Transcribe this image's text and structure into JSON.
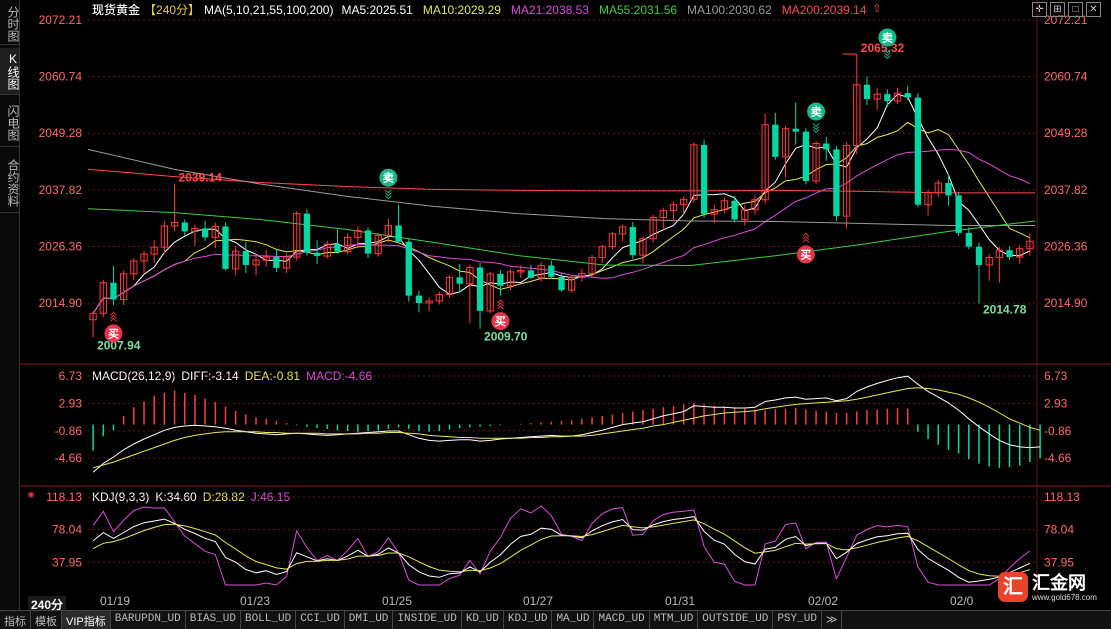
{
  "nav_tabs": [
    "分时图",
    "K线图",
    "闪电图",
    "合约资料"
  ],
  "nav_active": 1,
  "header": {
    "title": "现货黄金",
    "period_tag": "【240分】",
    "ma_params": "MA(5,10,21,55,100,200)",
    "ma_values": [
      {
        "label": "MA5:2025.51",
        "color": "#ffffff"
      },
      {
        "label": "MA10:2029.29",
        "color": "#e6e65c"
      },
      {
        "label": "MA21:2038.53",
        "color": "#d94ed9"
      },
      {
        "label": "MA55:2031.56",
        "color": "#3fcf3f"
      },
      {
        "label": "MA100:2030.62",
        "color": "#9a9a9a"
      },
      {
        "label": "MA200:2039.14",
        "color": "#ff4a4a"
      }
    ]
  },
  "colors": {
    "up": "#ff3b3b",
    "down": "#00d8a4",
    "bg": "#000000",
    "grid": "#5a1a1a"
  },
  "price_axis_ticks": [
    "2072.21",
    "2060.74",
    "2049.28",
    "2037.82",
    "2026.36",
    "2014.90"
  ],
  "macd_panel": {
    "title": "MACD(26,12,9)",
    "diff": "DIFF:-3.14",
    "dea": "DEA:-0.81",
    "macd": "MACD:-4.66",
    "ticks": [
      "6.73",
      "2.93",
      "-0.86",
      "-4.66"
    ]
  },
  "kdj_panel": {
    "title": "KDJ(9,3,3)",
    "k": "K:34.60",
    "d": "D:28.82",
    "j": "J:46.15",
    "ticks": [
      "118.13",
      "78.04",
      "37.95"
    ]
  },
  "annotations": {
    "high": "2065.32",
    "low_a": "2007.94",
    "low_b": "2009.70",
    "low_c": "2014.78",
    "prev_high": "2039.14",
    "buy": "买",
    "sell": "卖"
  },
  "period_label": "240分",
  "date_labels": [
    "01/19",
    "01/23",
    "01/25",
    "01/27",
    "01/31",
    "02/02",
    "02/0"
  ],
  "bottom_tabs": [
    "指标",
    "模板",
    "VIP指标",
    "BARUPDN_UD",
    "BIAS_UD",
    "BOLL_UD",
    "CCI_UD",
    "DMI_UD",
    "INSIDE_UD",
    "KD_UD",
    "KDJ_UD",
    "MA_UD",
    "MACD_UD",
    "MTM_UD",
    "OUTSIDE_UD",
    "PSY_UD",
    "≫"
  ],
  "bottom_active": 2,
  "logo": {
    "mark": "汇",
    "name": "汇金网",
    "url": "www.gold678.com"
  },
  "chart_data": {
    "type": "candlestick",
    "candles": [
      [
        2011.5,
        2013.2,
        2007.9,
        2012.8
      ],
      [
        2012.8,
        2019.6,
        2012.0,
        2019.0
      ],
      [
        2019.0,
        2022.4,
        2014.5,
        2015.6
      ],
      [
        2015.6,
        2021.5,
        2014.5,
        2020.8
      ],
      [
        2020.8,
        2024.0,
        2019.5,
        2023.4
      ],
      [
        2023.4,
        2025.5,
        2021.0,
        2024.8
      ],
      [
        2024.8,
        2027.6,
        2023.0,
        2026.2
      ],
      [
        2026.2,
        2031.5,
        2025.0,
        2030.5
      ],
      [
        2030.5,
        2039.1,
        2029.5,
        2031.2
      ],
      [
        2031.2,
        2031.8,
        2028.6,
        2029.4
      ],
      [
        2029.4,
        2030.8,
        2026.5,
        2030.0
      ],
      [
        2030.0,
        2031.5,
        2027.5,
        2028.2
      ],
      [
        2028.2,
        2031.2,
        2026.0,
        2030.4
      ],
      [
        2030.4,
        2031.2,
        2021.5,
        2021.8
      ],
      [
        2021.8,
        2026.5,
        2020.5,
        2025.4
      ],
      [
        2025.4,
        2027.2,
        2021.0,
        2022.6
      ],
      [
        2022.6,
        2024.8,
        2020.5,
        2023.6
      ],
      [
        2023.6,
        2025.6,
        2022.2,
        2024.2
      ],
      [
        2024.2,
        2025.8,
        2021.2,
        2022.0
      ],
      [
        2022.0,
        2024.9,
        2021.0,
        2024.2
      ],
      [
        2024.2,
        2033.5,
        2023.5,
        2033.0
      ],
      [
        2033.0,
        2033.8,
        2024.5,
        2025.1
      ],
      [
        2025.1,
        2027.6,
        2022.8,
        2024.4
      ],
      [
        2024.4,
        2027.5,
        2023.9,
        2026.8
      ],
      [
        2026.8,
        2029.8,
        2024.9,
        2025.3
      ],
      [
        2025.3,
        2029.0,
        2024.8,
        2028.2
      ],
      [
        2028.2,
        2030.4,
        2026.0,
        2029.6
      ],
      [
        2029.6,
        2030.2,
        2024.0,
        2024.9
      ],
      [
        2024.9,
        2029.1,
        2024.3,
        2028.6
      ],
      [
        2028.6,
        2032.0,
        2027.2,
        2030.6
      ],
      [
        2030.6,
        2034.8,
        2027.0,
        2027.3
      ],
      [
        2027.3,
        2028.0,
        2015.2,
        2016.4
      ],
      [
        2016.4,
        2017.4,
        2013.0,
        2014.9
      ],
      [
        2014.9,
        2016.0,
        2013.2,
        2015.3
      ],
      [
        2015.3,
        2017.2,
        2014.6,
        2016.6
      ],
      [
        2016.6,
        2020.5,
        2015.9,
        2020.1
      ],
      [
        2020.1,
        2022.8,
        2017.0,
        2018.8
      ],
      [
        2018.8,
        2022.5,
        2010.8,
        2022.1
      ],
      [
        2022.1,
        2023.0,
        2009.7,
        2013.3
      ],
      [
        2013.3,
        2021.2,
        2012.8,
        2020.8
      ],
      [
        2020.8,
        2021.6,
        2016.4,
        2018.4
      ],
      [
        2018.4,
        2021.8,
        2017.5,
        2021.2
      ],
      [
        2021.2,
        2022.5,
        2020.0,
        2021.5
      ],
      [
        2021.5,
        2022.6,
        2019.8,
        2020.0
      ],
      [
        2020.0,
        2023.2,
        2019.2,
        2022.5
      ],
      [
        2022.5,
        2023.5,
        2019.8,
        2020.2
      ],
      [
        2020.2,
        2020.9,
        2017.2,
        2017.5
      ],
      [
        2017.5,
        2020.6,
        2017.0,
        2020.1
      ],
      [
        2020.1,
        2021.8,
        2019.2,
        2020.9
      ],
      [
        2020.9,
        2024.6,
        2020.2,
        2024.1
      ],
      [
        2024.1,
        2026.7,
        2023.0,
        2026.3
      ],
      [
        2026.3,
        2029.3,
        2025.7,
        2028.9
      ],
      [
        2028.9,
        2030.8,
        2027.4,
        2030.3
      ],
      [
        2030.3,
        2031.3,
        2023.8,
        2024.6
      ],
      [
        2024.6,
        2028.4,
        2023.0,
        2027.9
      ],
      [
        2027.9,
        2032.7,
        2027.1,
        2032.2
      ],
      [
        2032.2,
        2034.2,
        2030.0,
        2033.6
      ],
      [
        2033.6,
        2035.5,
        2031.4,
        2034.8
      ],
      [
        2034.8,
        2036.5,
        2032.8,
        2035.9
      ],
      [
        2035.9,
        2047.4,
        2035.2,
        2046.9
      ],
      [
        2046.9,
        2048.0,
        2032.2,
        2032.9
      ],
      [
        2032.9,
        2034.8,
        2031.0,
        2033.8
      ],
      [
        2033.8,
        2036.3,
        2033.0,
        2035.6
      ],
      [
        2035.6,
        2036.6,
        2031.2,
        2031.8
      ],
      [
        2031.8,
        2034.7,
        2030.6,
        2033.8
      ],
      [
        2033.8,
        2036.7,
        2032.8,
        2035.8
      ],
      [
        2035.8,
        2053.2,
        2035.0,
        2051.0
      ],
      [
        2051.0,
        2053.4,
        2043.9,
        2044.5
      ],
      [
        2044.5,
        2050.8,
        2040.3,
        2050.2
      ],
      [
        2050.2,
        2055.5,
        2047.0,
        2049.6
      ],
      [
        2049.6,
        2050.3,
        2038.9,
        2039.6
      ],
      [
        2039.6,
        2047.7,
        2039.0,
        2047.2
      ],
      [
        2047.2,
        2048.5,
        2043.7,
        2046.0
      ],
      [
        2046.0,
        2046.7,
        2031.5,
        2032.5
      ],
      [
        2032.5,
        2047.5,
        2030.0,
        2046.8
      ],
      [
        2046.8,
        2065.3,
        2045.0,
        2059.1
      ],
      [
        2059.1,
        2060.8,
        2055.0,
        2056.2
      ],
      [
        2056.2,
        2058.4,
        2054.0,
        2057.2
      ],
      [
        2057.2,
        2058.2,
        2054.6,
        2055.8
      ],
      [
        2055.8,
        2058.5,
        2055.2,
        2057.4
      ],
      [
        2057.4,
        2058.9,
        2056.0,
        2056.5
      ],
      [
        2056.5,
        2057.4,
        2034.3,
        2034.8
      ],
      [
        2034.8,
        2037.8,
        2032.6,
        2037.2
      ],
      [
        2037.2,
        2039.9,
        2036.4,
        2039.2
      ],
      [
        2039.2,
        2041.0,
        2034.6,
        2036.7
      ],
      [
        2036.7,
        2037.4,
        2028.5,
        2029.1
      ],
      [
        2029.1,
        2030.2,
        2025.8,
        2026.3
      ],
      [
        2026.3,
        2027.1,
        2014.8,
        2022.6
      ],
      [
        2022.6,
        2024.8,
        2019.4,
        2024.1
      ],
      [
        2024.1,
        2026.2,
        2019.0,
        2025.6
      ],
      [
        2025.6,
        2026.3,
        2023.6,
        2024.2
      ],
      [
        2024.2,
        2026.6,
        2022.8,
        2025.9
      ],
      [
        2025.9,
        2029.0,
        2024.5,
        2027.4
      ]
    ],
    "macd_hist": [
      -3.6,
      -1.6,
      -0.8,
      1.2,
      2.4,
      3.2,
      4.0,
      4.4,
      4.7,
      4.4,
      4.1,
      3.6,
      3.1,
      2.5,
      1.9,
      1.4,
      1.0,
      0.8,
      0.5,
      0.2,
      -0.1,
      -0.3,
      -0.5,
      -0.6,
      -0.8,
      -0.9,
      -1.0,
      -0.9,
      -0.8,
      -0.6,
      -0.4,
      -0.6,
      -0.9,
      -1.0,
      -0.9,
      -0.7,
      -0.5,
      -0.4,
      -0.3,
      -0.2,
      -0.1,
      0.0,
      0.1,
      0.2,
      0.3,
      0.4,
      0.5,
      0.6,
      0.8,
      1.0,
      1.2,
      1.4,
      1.6,
      1.8,
      2.0,
      2.2,
      2.4,
      2.6,
      2.8,
      3.0,
      2.8,
      2.6,
      2.5,
      2.4,
      2.2,
      2.1,
      2.0,
      2.1,
      2.2,
      2.3,
      2.1,
      1.9,
      1.8,
      1.6,
      1.6,
      1.8,
      2.0,
      2.1,
      2.2,
      2.3,
      2.2,
      -1.0,
      -2.0,
      -2.8,
      -3.5,
      -4.0,
      -4.8,
      -5.4,
      -5.8,
      -6.0,
      -5.9,
      -5.7,
      -5.2,
      -4.7
    ],
    "diff": [
      -6.6,
      -5.4,
      -4.5,
      -3.5,
      -2.7,
      -2.0,
      -1.4,
      -0.8,
      -0.4,
      -0.2,
      -0.1,
      -0.2,
      -0.3,
      -0.5,
      -0.8,
      -1.0,
      -1.2,
      -1.3,
      -1.4,
      -1.3,
      -1.2,
      -1.3,
      -1.4,
      -1.5,
      -1.4,
      -1.3,
      -1.2,
      -1.1,
      -1.0,
      -0.9,
      -0.9,
      -1.4,
      -1.9,
      -2.2,
      -2.3,
      -2.2,
      -2.1,
      -2.1,
      -2.3,
      -2.2,
      -2.0,
      -1.9,
      -1.8,
      -1.7,
      -1.6,
      -1.5,
      -1.6,
      -1.6,
      -1.4,
      -1.1,
      -0.8,
      -0.4,
      0.0,
      0.2,
      0.4,
      0.8,
      1.2,
      1.5,
      1.8,
      2.6,
      2.5,
      2.4,
      2.4,
      2.3,
      2.3,
      2.4,
      3.2,
      3.4,
      3.7,
      3.8,
      3.5,
      3.6,
      3.7,
      3.3,
      3.6,
      4.6,
      5.2,
      5.7,
      6.1,
      6.5,
      6.7,
      5.6,
      4.6,
      3.8,
      3.0,
      2.0,
      0.8,
      -0.3,
      -1.3,
      -2.2,
      -2.8,
      -3.1,
      -3.2,
      -3.1
    ],
    "dea": [
      -6.0,
      -5.6,
      -5.2,
      -4.7,
      -4.2,
      -3.7,
      -3.2,
      -2.7,
      -2.2,
      -1.8,
      -1.5,
      -1.3,
      -1.1,
      -1.0,
      -1.0,
      -1.0,
      -1.0,
      -1.1,
      -1.1,
      -1.2,
      -1.2,
      -1.2,
      -1.2,
      -1.3,
      -1.3,
      -1.3,
      -1.3,
      -1.2,
      -1.2,
      -1.1,
      -1.1,
      -1.2,
      -1.3,
      -1.5,
      -1.6,
      -1.7,
      -1.8,
      -1.8,
      -1.9,
      -1.9,
      -1.9,
      -1.9,
      -1.9,
      -1.8,
      -1.8,
      -1.7,
      -1.7,
      -1.6,
      -1.6,
      -1.5,
      -1.3,
      -1.1,
      -0.9,
      -0.7,
      -0.5,
      -0.2,
      0.0,
      0.3,
      0.6,
      0.9,
      1.2,
      1.4,
      1.6,
      1.7,
      1.8,
      1.9,
      2.2,
      2.4,
      2.6,
      2.8,
      2.9,
      3.0,
      3.1,
      3.2,
      3.3,
      3.5,
      3.8,
      4.1,
      4.4,
      4.7,
      5.0,
      5.1,
      5.0,
      4.8,
      4.5,
      4.2,
      3.7,
      3.1,
      2.4,
      1.6,
      0.8,
      0.2,
      -0.4,
      -0.8
    ]
  }
}
